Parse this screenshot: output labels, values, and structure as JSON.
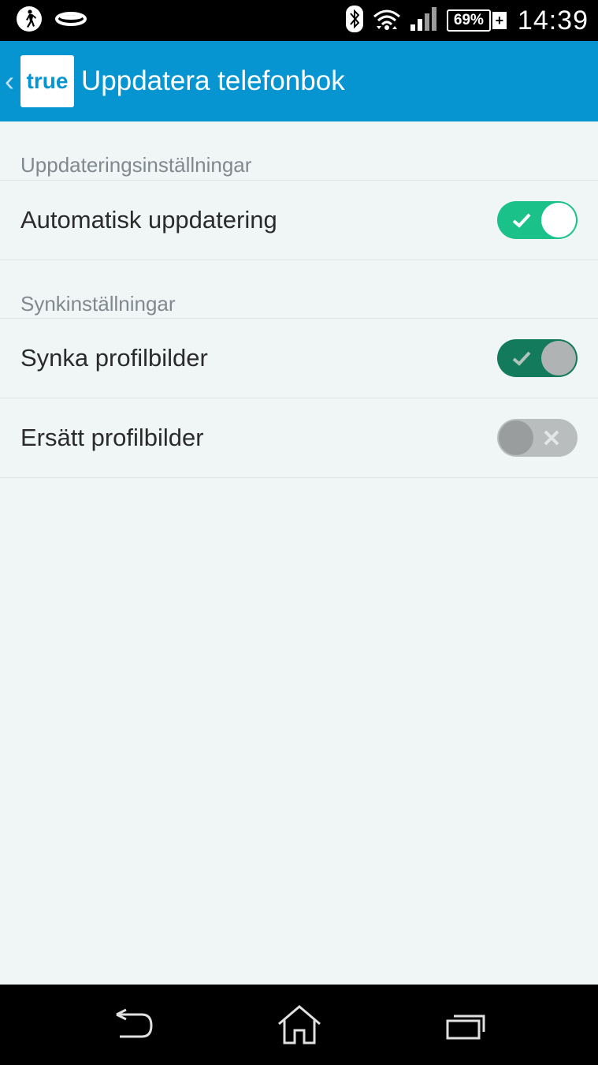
{
  "status_bar": {
    "battery_level": "69%",
    "time": "14:39",
    "icons": [
      "walking-icon",
      "ring-icon",
      "bluetooth-icon",
      "wifi-icon",
      "signal-icon",
      "battery-icon"
    ]
  },
  "app_bar": {
    "logo_text": "true",
    "title": "Uppdatera telefonbok"
  },
  "sections": [
    {
      "header": "Uppdateringsinställningar",
      "rows": [
        {
          "label": "Automatisk uppdatering",
          "toggle": "on"
        }
      ]
    },
    {
      "header": "Synkinställningar",
      "rows": [
        {
          "label": "Synka profilbilder",
          "toggle": "on"
        },
        {
          "label": "Ersätt profilbilder",
          "toggle": "off"
        }
      ]
    }
  ],
  "colors": {
    "app_bar": "#0795d2",
    "toggle_on": "#1ac28a",
    "toggle_on_dark": "#137a5b",
    "toggle_off": "#b9bdbe",
    "background": "#f0f6f5"
  }
}
